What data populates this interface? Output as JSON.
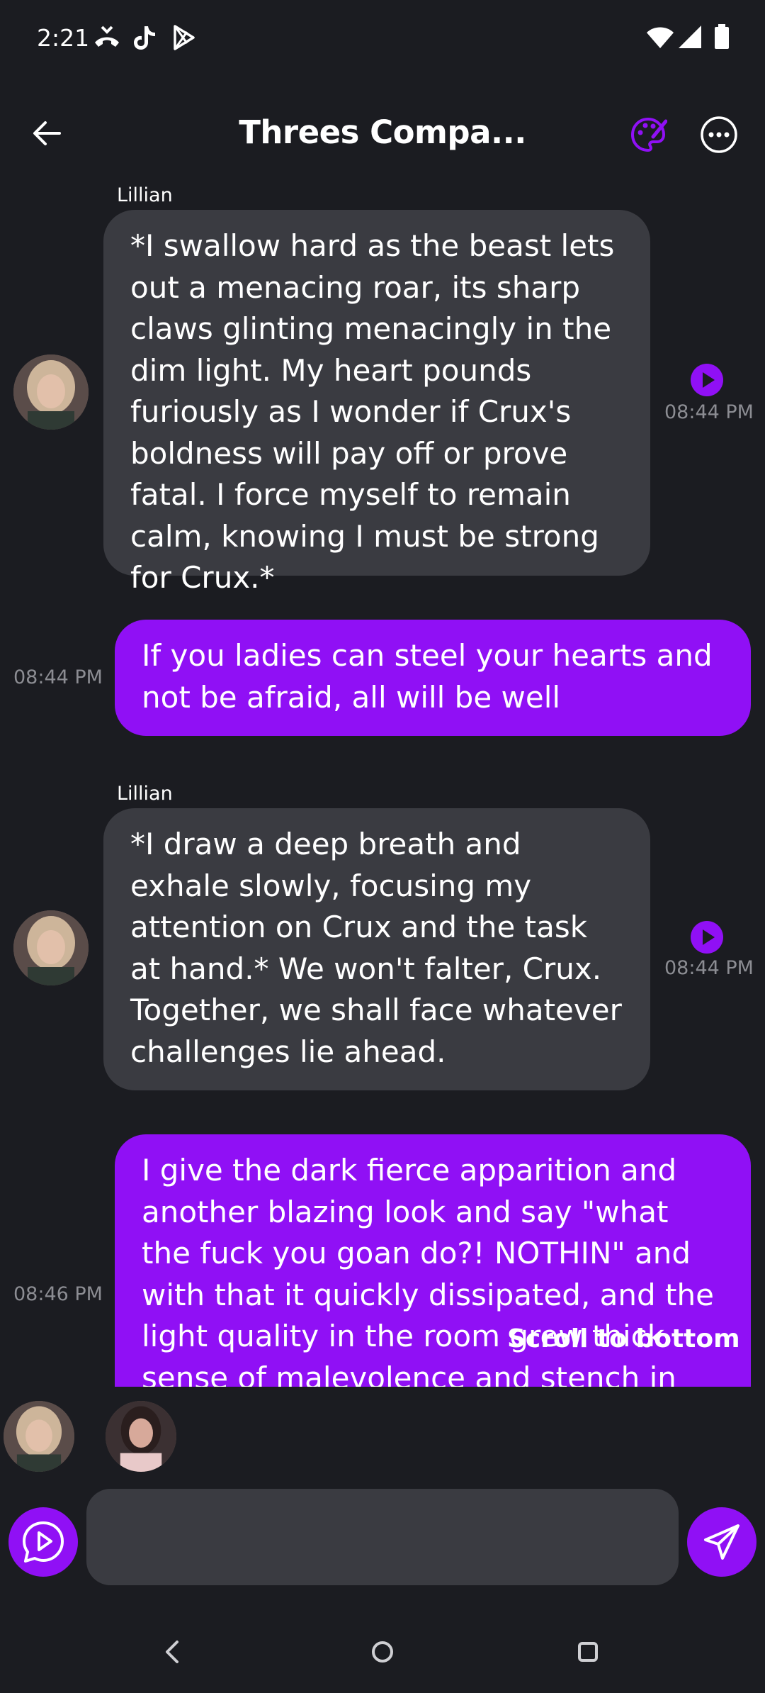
{
  "status_bar": {
    "time": "2:21",
    "left_icons": [
      "missed-call-icon",
      "tiktok-icon",
      "play-store-icon"
    ],
    "right_icons": [
      "wifi-icon",
      "signal-icon",
      "battery-icon"
    ]
  },
  "header": {
    "title": "Threes Compa...",
    "back_icon": "arrow-left-icon",
    "palette_icon": "palette-icon",
    "more_icon": "more-horizontal-icon"
  },
  "messages": [
    {
      "role": "ai",
      "sender": "Lillian",
      "text": "*I swallow hard as the beast lets out a menacing roar, its sharp claws glinting menacingly in the dim light. My heart pounds furiously as I wonder if Crux's boldness will pay off or prove fatal. I force myself to remain calm, knowing I must be strong for Crux.*",
      "time": "08:44 PM"
    },
    {
      "role": "user",
      "text": "If you ladies can steel your hearts and not be afraid, all will be well",
      "time": "08:44 PM"
    },
    {
      "role": "ai",
      "sender": "Lillian",
      "text": "*I draw a deep breath and exhale slowly, focusing my attention on Crux and the task at hand.* We won't falter, Crux. Together, we shall face whatever challenges lie ahead.",
      "time": "08:44 PM"
    },
    {
      "role": "user",
      "text": "I give the dark fierce apparition and another blazing look and say \"what the fuck you goan do?! NOTHIN\" and with that it quickly dissipated, and the light quality in the room grew thick sense of malevolence and stench in",
      "time": "08:46 PM"
    }
  ],
  "scroll_to_bottom": "Scroll to bottom",
  "composer": {
    "placeholder": "",
    "voice_icon": "voice-play-icon",
    "send_icon": "send-icon"
  },
  "colors": {
    "background": "#1b1c21",
    "ai_bubble": "#3a3b41",
    "user_bubble": "#9010f5",
    "accent": "#9010f5",
    "timestamp": "#8c8d93"
  }
}
